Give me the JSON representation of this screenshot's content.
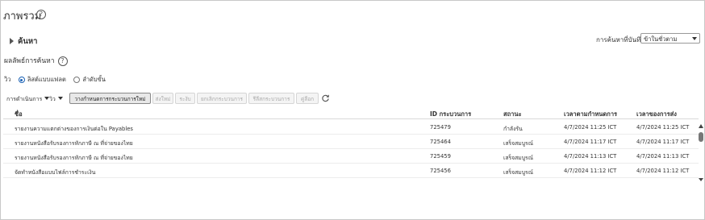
{
  "page": {
    "title": "ภาพรวม",
    "help_glyph": "?"
  },
  "search": {
    "toggle_label": "ค้นหา",
    "saved_search_label": "การค้นหาที่บันทึก",
    "saved_search_value": "ข้าในชั่วตาม"
  },
  "results": {
    "title": "ผลลัพธ์การค้นหา",
    "view_label": "วิว",
    "view_options": [
      "ลิสต์แบบแฟลต",
      "ลำดับขั้น"
    ]
  },
  "toolbar": {
    "actions_menu": "การดำเนินการ",
    "view_menu": "วิว",
    "buttons": [
      "วางกำหนดการกระบวนการใหม่",
      "ส่งใหม่",
      "ระงับ",
      "ยกเลิกกระบวนการ",
      "รีลีสกระบวนการ",
      "คู่ลือก"
    ]
  },
  "table": {
    "columns": [
      "ชื่อ",
      "ID กระบวนการ",
      "สถานะ",
      "เวลาตามกำหนดการ",
      "เวลาของการส่ง"
    ],
    "rows": [
      [
        "รายงานความแตกต่างของการเงินต่อใน Payables",
        "725479",
        "กำลังรัน",
        "4/7/2024 11:25 ICT",
        "4/7/2024 11:25 ICT"
      ],
      [
        "รายงานหนังสือรับรองการหักภาษี ณ ที่จ่ายของไทย",
        "725464",
        "เสร็จสมบูรณ์",
        "4/7/2024 11:17 ICT",
        "4/7/2024 11:17 ICT"
      ],
      [
        "รายงานหนังสือรับรองการหักภาษี ณ ที่จ่ายของไทย",
        "725459",
        "เสร็จสมบูรณ์",
        "4/7/2024 11:13 ICT",
        "4/7/2024 11:13 ICT"
      ],
      [
        "จัดทำหนังสือแบบไฟล์การชำระเงิน",
        "725456",
        "เสร็จสมบูรณ์",
        "4/7/2024 11:12 ICT",
        "4/7/2024 11:12 ICT"
      ]
    ]
  }
}
